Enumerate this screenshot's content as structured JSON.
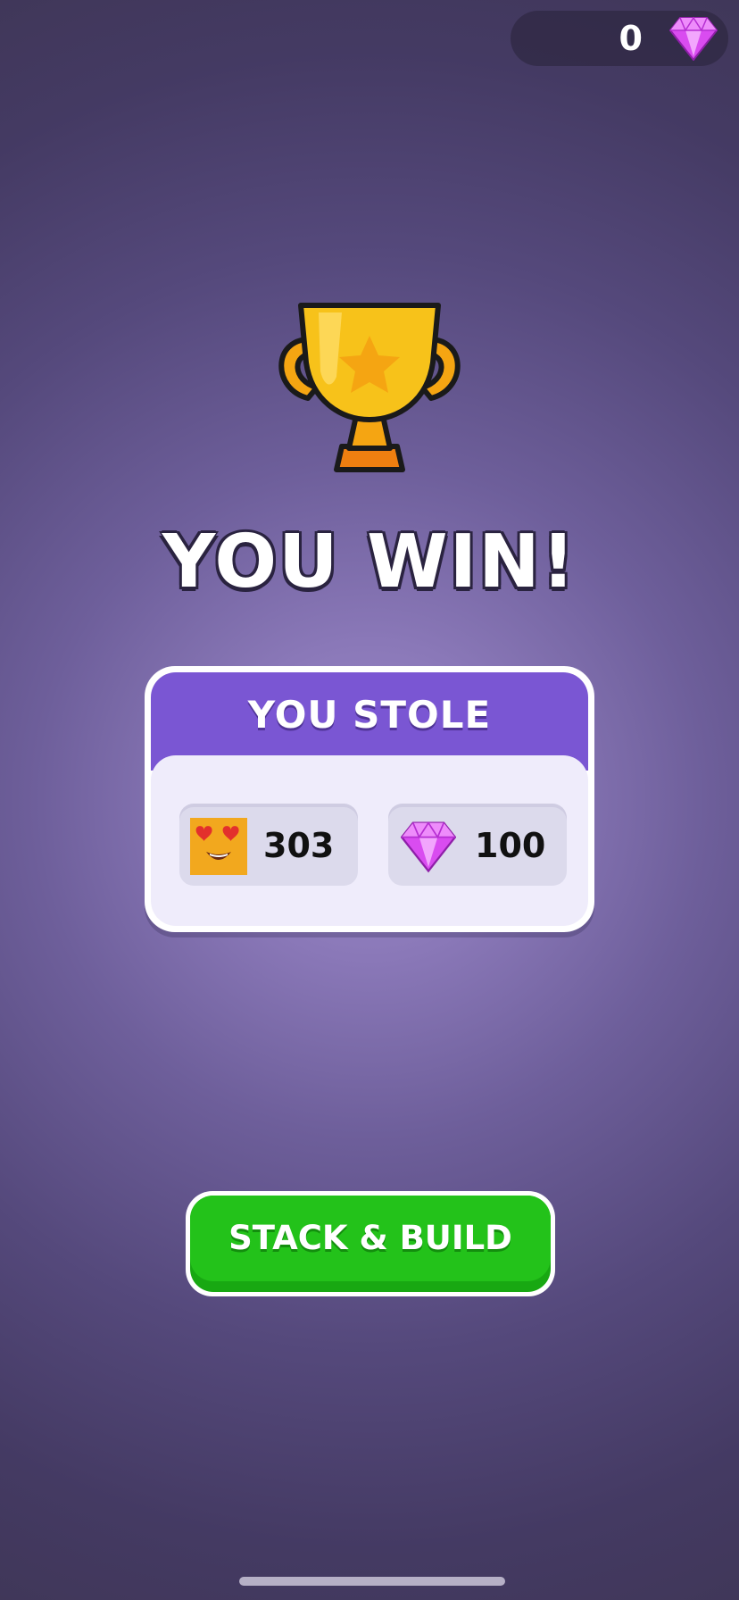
{
  "hud": {
    "gems": "0",
    "gem_icon": "pink-gem-icon"
  },
  "result": {
    "title": "YOU WIN!"
  },
  "stolen": {
    "header": "YOU STOLE",
    "items": [
      {
        "icon": "heart-eyes-emoji-icon",
        "value": "303"
      },
      {
        "icon": "pink-gem-icon",
        "value": "100"
      }
    ]
  },
  "actions": {
    "primary_label": "STACK & BUILD"
  },
  "colors": {
    "background": "#5a4d82",
    "card_header": "#7a56d3",
    "button": "#23c21a",
    "gem": "#d24fe8",
    "trophy": "#f7c21a"
  }
}
